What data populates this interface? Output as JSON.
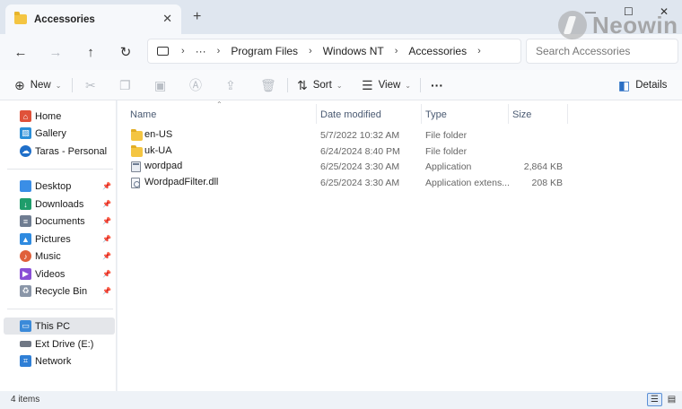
{
  "window": {
    "tab_title": "Accessories",
    "tab_close": "✕",
    "new_tab": "+",
    "controls": {
      "minimize": "—",
      "maximize": "☐",
      "close": "✕"
    }
  },
  "watermark": {
    "text": "Neowin"
  },
  "nav": {
    "back": "←",
    "forward": "→",
    "up": "↑",
    "refresh": "↻",
    "breadcrumbs": [
      "Program Files",
      "Windows NT",
      "Accessories"
    ],
    "ellipsis": "···",
    "separator": "›"
  },
  "search": {
    "placeholder": "Search Accessories",
    "value": ""
  },
  "commands": {
    "new": "New",
    "sort": "Sort",
    "view": "View",
    "more": "···",
    "details": "Details",
    "icons": {
      "new": "plus-icon",
      "cut": "scissors-icon",
      "copy": "copy-icon",
      "paste": "paste-icon",
      "rename": "rename-icon",
      "share": "share-icon",
      "delete": "trash-icon",
      "sort": "sort-icon",
      "view": "view-icon",
      "details": "details-pane-icon"
    }
  },
  "sidebar": {
    "quick": [
      {
        "label": "Home",
        "icon": "home-icon",
        "color": "#e0523a"
      },
      {
        "label": "Gallery",
        "icon": "gallery-icon",
        "color": "#2b8fd8"
      },
      {
        "label": "Taras - Personal",
        "icon": "onedrive-icon",
        "color": "#1f6fc9"
      }
    ],
    "pinned": [
      {
        "label": "Desktop",
        "icon": "desktop-icon",
        "color": "#3a8ee6"
      },
      {
        "label": "Downloads",
        "icon": "downloads-icon",
        "color": "#1f9d6b"
      },
      {
        "label": "Documents",
        "icon": "documents-icon",
        "color": "#6f7d91"
      },
      {
        "label": "Pictures",
        "icon": "pictures-icon",
        "color": "#2f8be0"
      },
      {
        "label": "Music",
        "icon": "music-icon",
        "color": "#e0603a"
      },
      {
        "label": "Videos",
        "icon": "videos-icon",
        "color": "#8a4fd6"
      },
      {
        "label": "Recycle Bin",
        "icon": "recycle-bin-icon",
        "color": "#8a96a8"
      }
    ],
    "devices": [
      {
        "label": "This PC",
        "icon": "this-pc-icon",
        "color": "#3b8ad9"
      },
      {
        "label": "Ext Drive (E:)",
        "icon": "drive-icon",
        "color": "#6f7784"
      },
      {
        "label": "Network",
        "icon": "network-icon",
        "color": "#2f7fd6"
      }
    ]
  },
  "columns": {
    "name": "Name",
    "date": "Date modified",
    "type": "Type",
    "size": "Size"
  },
  "files": [
    {
      "name": "en-US",
      "date": "5/7/2022 10:32 AM",
      "type": "File folder",
      "size": "",
      "kind": "folder"
    },
    {
      "name": "uk-UA",
      "date": "6/24/2024 8:40 PM",
      "type": "File folder",
      "size": "",
      "kind": "folder"
    },
    {
      "name": "wordpad",
      "date": "6/25/2024 3:30 AM",
      "type": "Application",
      "size": "2,864 KB",
      "kind": "app"
    },
    {
      "name": "WordpadFilter.dll",
      "date": "6/25/2024 3:30 AM",
      "type": "Application extens...",
      "size": "208 KB",
      "kind": "dll"
    }
  ],
  "status": {
    "item_count": "4 items"
  }
}
